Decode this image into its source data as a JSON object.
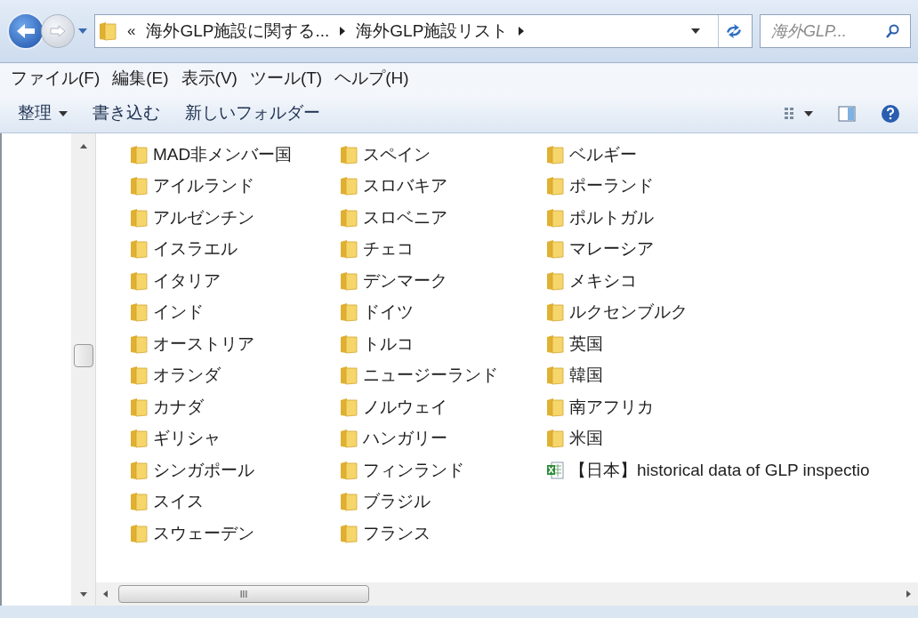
{
  "address": {
    "overflow": "«",
    "crumbs": [
      "海外GLP施設に関する...",
      "海外GLP施設リスト"
    ]
  },
  "search": {
    "placeholder": "海外GLP..."
  },
  "menu": [
    "ファイル(F)",
    "編集(E)",
    "表示(V)",
    "ツール(T)",
    "ヘルプ(H)"
  ],
  "commands": [
    {
      "label": "整理",
      "dropdown": true
    },
    {
      "label": "書き込む",
      "dropdown": false
    },
    {
      "label": "新しいフォルダー",
      "dropdown": false
    }
  ],
  "files": [
    {
      "name": "MAD非メンバー国",
      "kind": "folder"
    },
    {
      "name": "アイルランド",
      "kind": "folder"
    },
    {
      "name": "アルゼンチン",
      "kind": "folder"
    },
    {
      "name": "イスラエル",
      "kind": "folder"
    },
    {
      "name": "イタリア",
      "kind": "folder"
    },
    {
      "name": "インド",
      "kind": "folder"
    },
    {
      "name": "オーストリア",
      "kind": "folder"
    },
    {
      "name": "オランダ",
      "kind": "folder"
    },
    {
      "name": "カナダ",
      "kind": "folder"
    },
    {
      "name": "ギリシャ",
      "kind": "folder"
    },
    {
      "name": "シンガポール",
      "kind": "folder"
    },
    {
      "name": "スイス",
      "kind": "folder"
    },
    {
      "name": "スウェーデン",
      "kind": "folder"
    },
    {
      "name": "スペイン",
      "kind": "folder"
    },
    {
      "name": "スロバキア",
      "kind": "folder"
    },
    {
      "name": "スロベニア",
      "kind": "folder"
    },
    {
      "name": "チェコ",
      "kind": "folder"
    },
    {
      "name": "デンマーク",
      "kind": "folder"
    },
    {
      "name": "ドイツ",
      "kind": "folder"
    },
    {
      "name": "トルコ",
      "kind": "folder"
    },
    {
      "name": "ニュージーランド",
      "kind": "folder"
    },
    {
      "name": "ノルウェイ",
      "kind": "folder"
    },
    {
      "name": "ハンガリー",
      "kind": "folder"
    },
    {
      "name": "フィンランド",
      "kind": "folder"
    },
    {
      "name": "ブラジル",
      "kind": "folder"
    },
    {
      "name": "フランス",
      "kind": "folder"
    },
    {
      "name": "ベルギー",
      "kind": "folder"
    },
    {
      "name": "ポーランド",
      "kind": "folder"
    },
    {
      "name": "ポルトガル",
      "kind": "folder"
    },
    {
      "name": "マレーシア",
      "kind": "folder"
    },
    {
      "name": "メキシコ",
      "kind": "folder"
    },
    {
      "name": "ルクセンブルク",
      "kind": "folder"
    },
    {
      "name": "英国",
      "kind": "folder"
    },
    {
      "name": "韓国",
      "kind": "folder"
    },
    {
      "name": "南アフリカ",
      "kind": "folder"
    },
    {
      "name": "米国",
      "kind": "folder"
    },
    {
      "name": "【日本】historical data of GLP inspectio",
      "kind": "excel"
    }
  ],
  "scroll_label": "III"
}
